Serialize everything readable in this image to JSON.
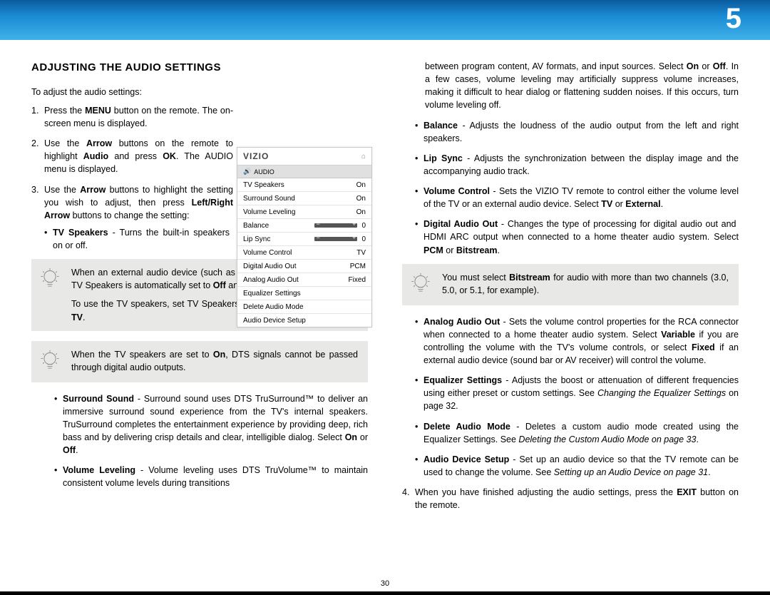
{
  "chapter": "5",
  "pageNumber": "30",
  "heading": "ADJUSTING THE AUDIO SETTINGS",
  "intro": "To adjust the audio settings:",
  "menuScreenshot": {
    "brand": "VIZIO",
    "title": "AUDIO",
    "rows": {
      "tvSpeakers": {
        "label": "TV Speakers",
        "value": "On"
      },
      "surround": {
        "label": "Surround Sound",
        "value": "On"
      },
      "leveling": {
        "label": "Volume Leveling",
        "value": "On"
      },
      "balance": {
        "label": "Balance",
        "value": "0"
      },
      "lipsync": {
        "label": "Lip Sync",
        "value": "0"
      },
      "volctrl": {
        "label": "Volume Control",
        "value": "TV"
      },
      "digital": {
        "label": "Digital Audio Out",
        "value": "PCM"
      },
      "analog": {
        "label": "Analog Audio Out",
        "value": "Fixed"
      },
      "eq": {
        "label": "Equalizer Settings",
        "value": ""
      },
      "delmode": {
        "label": "Delete Audio Mode",
        "value": ""
      },
      "devsetup": {
        "label": "Audio Device Setup",
        "value": ""
      }
    }
  },
  "tipBitstream": "for audio with more than two channels (3.0, 5.0, or 5.1, for example).",
  "finalStep_b": "When you have finished adjusting the audio settings, press the ",
  "finalStep_exit": "EXIT",
  "finalStep_c": " button on the remote."
}
